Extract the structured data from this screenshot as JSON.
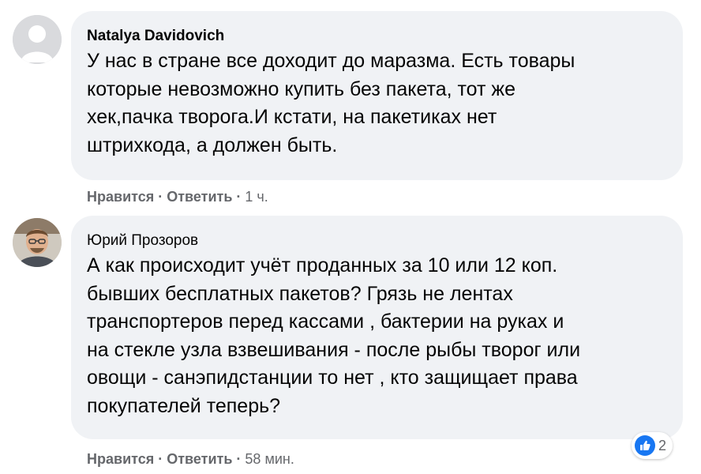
{
  "colors": {
    "bubble_bg": "#f0f2f5",
    "meta_text": "#65676b",
    "like_blue": "#1877f2"
  },
  "comments": [
    {
      "author": "Natalya Davidovich",
      "text": "У нас в стране все доходит до маразма. Есть товары\nкоторые невозможно купить без пакета, тот же\nхек,пачка творога.И кстати, на пакетиках нет\nштрихкода, а должен быть.",
      "like_label": "Нравится",
      "reply_label": "Ответить",
      "separator": "·",
      "time": "1 ч.",
      "avatar_icon": "default-profile-silhouette-icon"
    },
    {
      "author": "Юрий Прозоров",
      "text": "А как происходит учёт проданных за 10 или 12 коп.\nбывших бесплатных пакетов? Грязь не лентах\nтранспортеров перед кассами , бактерии на руках и\nна стекле узла взвешивания - после рыбы творог или\nовощи - санэпидстанции то нет , кто защищает права\nпокупателей теперь?",
      "like_label": "Нравится",
      "reply_label": "Ответить",
      "separator": "·",
      "time": "58 мин.",
      "avatar_icon": "profile-photo",
      "reactions": {
        "icon": "like-icon",
        "count": "2"
      }
    }
  ]
}
